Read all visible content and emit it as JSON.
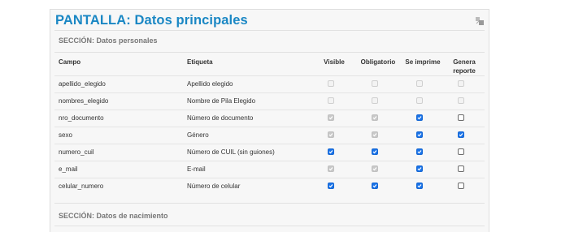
{
  "panel": {
    "title": "PANTALLA: Datos principales",
    "icon": "collapse-toggle-icon"
  },
  "sections": [
    {
      "title": "SECCIÓN: Datos personales"
    },
    {
      "title": "SECCIÓN: Datos de nacimiento"
    }
  ],
  "columns": {
    "campo": "Campo",
    "etiqueta": "Etiqueta",
    "visible": "Visible",
    "obligatorio": "Obligatorio",
    "se_imprime": "Se imprime",
    "genera_reporte_1": "Genera",
    "genera_reporte_2": "reporte"
  },
  "rows": [
    {
      "campo": "apellido_elegido",
      "etiqueta": "Apellido elegido",
      "visible": "disabled-off",
      "obligatorio": "disabled-off",
      "se_imprime": "disabled-off",
      "genera_reporte": "disabled-off"
    },
    {
      "campo": "nombres_elegido",
      "etiqueta": "Nombre de Pila Elegido",
      "visible": "disabled-off",
      "obligatorio": "disabled-off",
      "se_imprime": "disabled-off",
      "genera_reporte": "disabled-off"
    },
    {
      "campo": "nro_documento",
      "etiqueta": "Número de documento",
      "visible": "disabled-on",
      "obligatorio": "disabled-on",
      "se_imprime": "on",
      "genera_reporte": "off"
    },
    {
      "campo": "sexo",
      "etiqueta": "Género",
      "visible": "disabled-on",
      "obligatorio": "disabled-on",
      "se_imprime": "on",
      "genera_reporte": "on"
    },
    {
      "campo": "numero_cuil",
      "etiqueta": "Número de CUIL (sin guiones)",
      "visible": "on",
      "obligatorio": "on",
      "se_imprime": "on",
      "genera_reporte": "off"
    },
    {
      "campo": "e_mail",
      "etiqueta": "E-mail",
      "visible": "disabled-on",
      "obligatorio": "disabled-on",
      "se_imprime": "on",
      "genera_reporte": "off"
    },
    {
      "campo": "celular_numero",
      "etiqueta": "Número de celular",
      "visible": "on",
      "obligatorio": "on",
      "se_imprime": "on",
      "genera_reporte": "off"
    }
  ],
  "colors": {
    "title": "#1a87c4",
    "checkbox_checked": "#1a73e8",
    "checkbox_disabled": "#c8c8c8"
  }
}
